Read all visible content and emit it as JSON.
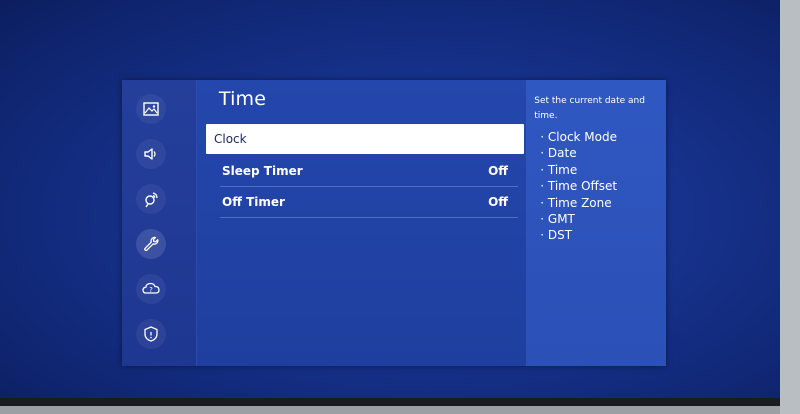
{
  "menu": {
    "title": "Time",
    "items": [
      {
        "label": "Clock",
        "value": "",
        "selected": true
      },
      {
        "label": "Sleep Timer",
        "value": "Off"
      },
      {
        "label": "Off Timer",
        "value": "Off"
      }
    ]
  },
  "sidebar": {
    "icons": [
      "picture-icon",
      "sound-icon",
      "broadcasting-icon",
      "general-wrench-icon",
      "support-icon",
      "privacy-shield-icon"
    ],
    "active": "general-wrench-icon"
  },
  "help": {
    "description": "Set the current date and time.",
    "items": [
      "Clock Mode",
      "Date",
      "Time",
      "Time Offset",
      "Time Zone",
      "GMT",
      "DST"
    ]
  },
  "colors": {
    "panel_main": "#2447ad",
    "panel_help": "#3058c2",
    "sidebar": "#243f9b",
    "focus": "#ffffff"
  }
}
